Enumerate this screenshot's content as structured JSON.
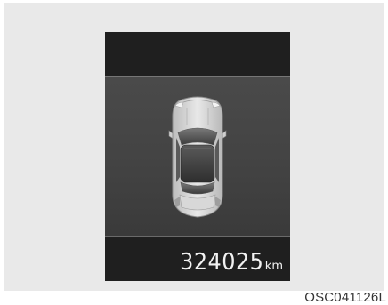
{
  "display": {
    "odometer_value": "324025",
    "odometer_unit": "km",
    "vehicle_icon": "car-top-view-icon"
  },
  "caption": {
    "code": "OSC041126L"
  }
}
